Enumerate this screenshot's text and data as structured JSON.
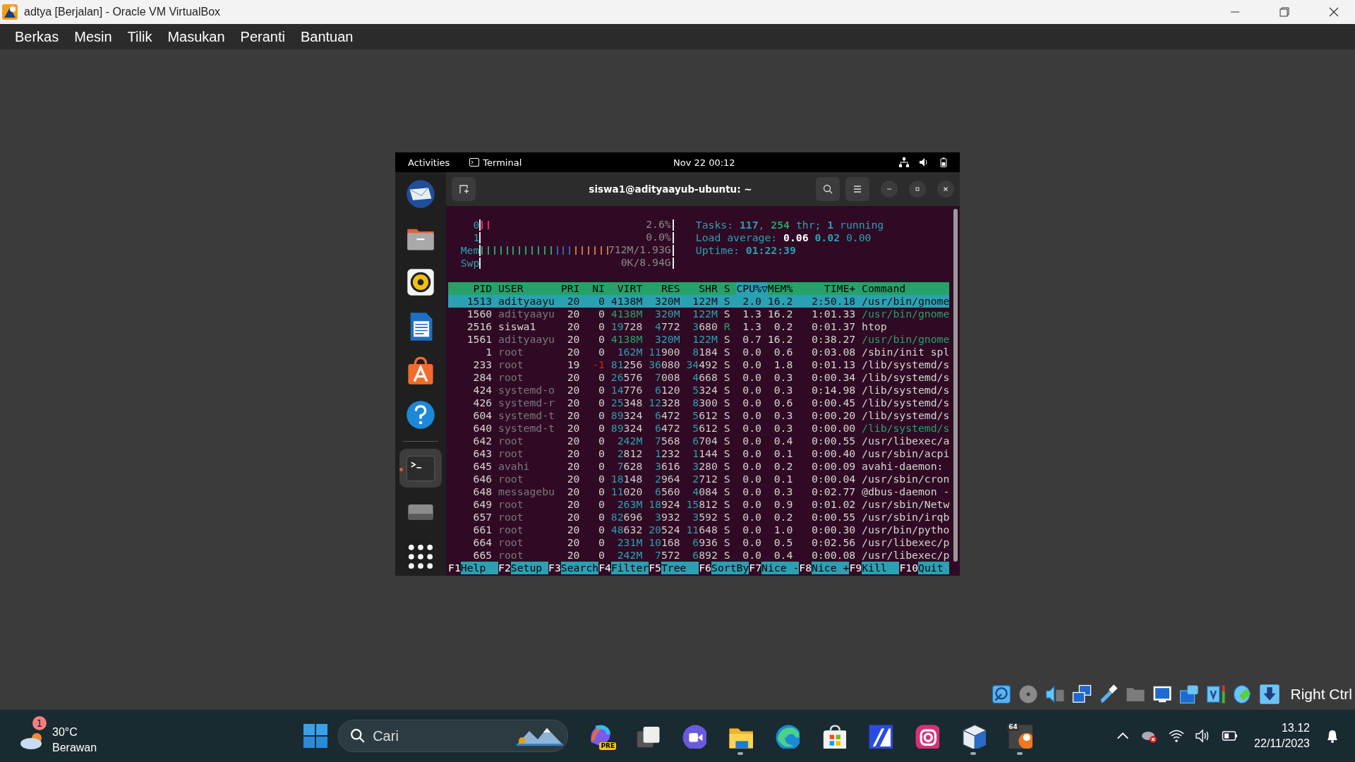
{
  "window": {
    "title": "adtya [Berjalan] - Oracle VM VirtualBox"
  },
  "menu": [
    "Berkas",
    "Mesin",
    "Tilik",
    "Masukan",
    "Peranti",
    "Bantuan"
  ],
  "guest": {
    "top_bar": {
      "activities": "Activities",
      "app": "Terminal",
      "clock": "Nov 22  00:12"
    },
    "dock": [
      {
        "kind": "mail",
        "selected": false
      },
      {
        "kind": "files",
        "selected": false
      },
      {
        "kind": "music",
        "selected": false
      },
      {
        "kind": "document",
        "selected": false
      },
      {
        "kind": "store",
        "selected": false
      },
      {
        "kind": "help",
        "selected": false
      },
      {
        "kind": "terminal",
        "selected": true
      },
      {
        "kind": "drive",
        "selected": false
      },
      {
        "kind": "apps",
        "selected": false
      }
    ],
    "terminal": {
      "title": "siswa1@adityaayub-ubuntu: ~",
      "meters": [
        {
          "label": "0",
          "kind": "cpu",
          "level": 0.06,
          "reading": "2.6%"
        },
        {
          "label": "1",
          "kind": "cpu",
          "level": 0,
          "reading": "0.0%"
        },
        {
          "label": "Mem",
          "kind": "memory",
          "level": 0.67,
          "reading": "712M/1.93G"
        },
        {
          "label": "Swp",
          "kind": "swap",
          "level": 0,
          "reading": "0K/8.94G"
        }
      ],
      "info": [
        [
          {
            "text": "Tasks: ",
            "kind": "label"
          },
          {
            "text": "117",
            "kind": "value"
          },
          {
            "text": ", ",
            "kind": "label"
          },
          {
            "text": "254",
            "kind": "thread"
          },
          {
            "text": " thr; ",
            "kind": "label"
          },
          {
            "text": "1",
            "kind": "value"
          },
          {
            "text": " running",
            "kind": "label"
          }
        ],
        [
          {
            "text": "Load average: ",
            "kind": "label"
          },
          {
            "text": "0.06",
            "kind": "high"
          },
          {
            "text": " 0.02",
            "kind": "value"
          },
          {
            "text": " 0.00",
            "kind": "label"
          }
        ],
        [
          {
            "text": "Uptime: ",
            "kind": "label"
          },
          {
            "text": "01:22:39",
            "kind": "value"
          }
        ]
      ],
      "columns": [
        {
          "label": "PID",
          "selected": false
        },
        {
          "label": "USER",
          "selected": false
        },
        {
          "label": "PRI",
          "selected": false
        },
        {
          "label": "NI",
          "selected": false
        },
        {
          "label": "VIRT",
          "selected": false
        },
        {
          "label": "RES",
          "selected": false
        },
        {
          "label": "SHR",
          "selected": false
        },
        {
          "label": "S",
          "selected": false
        },
        {
          "label": "CPU%▽",
          "selected": true
        },
        {
          "label": "MEM%",
          "selected": false
        },
        {
          "label": "TIME+",
          "selected": false
        },
        {
          "label": "Command",
          "selected": false
        }
      ],
      "rows": [
        {
          "pid": "1513",
          "user": "adityaayu",
          "pri": "20",
          "ni": "0",
          "virt": "4138M",
          "res": "320M",
          "shr": "122M",
          "state": "S",
          "cpu": "2.0",
          "mem": "16.2",
          "time": "2:50.18",
          "command": "/usr/bin/gnome",
          "selected": true
        },
        {
          "pid": "1560",
          "user": "adityaayu",
          "pri": "20",
          "ni": "0",
          "virt": "4138M",
          "res": "320M",
          "shr": "122M",
          "state": "S",
          "cpu": "1.3",
          "mem": "16.2",
          "time": "1:01.33",
          "command": "/usr/bin/gnome",
          "selected": false,
          "own_user": false,
          "thread": true,
          "running": false
        },
        {
          "pid": "2516",
          "user": "siswa1",
          "pri": "20",
          "ni": "0",
          "virt": "19728",
          "res": "4772",
          "shr": "3680",
          "state": "R",
          "cpu": "1.3",
          "mem": "0.2",
          "time": "0:01.37",
          "command": "htop",
          "selected": false,
          "own_user": true,
          "thread": false,
          "running": true
        },
        {
          "pid": "1561",
          "user": "adityaayu",
          "pri": "20",
          "ni": "0",
          "virt": "4138M",
          "res": "320M",
          "shr": "122M",
          "state": "S",
          "cpu": "0.7",
          "mem": "16.2",
          "time": "0:38.27",
          "command": "/usr/bin/gnome",
          "selected": false,
          "own_user": false,
          "thread": true,
          "running": false
        },
        {
          "pid": "1",
          "user": "root",
          "pri": "20",
          "ni": "0",
          "virt": "162M",
          "res": "11900",
          "shr": "8184",
          "state": "S",
          "cpu": "0.0",
          "mem": "0.6",
          "time": "0:03.08",
          "command": "/sbin/init spl",
          "selected": false,
          "own_user": false,
          "thread": false,
          "running": false
        },
        {
          "pid": "233",
          "user": "root",
          "pri": "19",
          "ni": "-1",
          "virt": "81256",
          "res": "36080",
          "shr": "34492",
          "state": "S",
          "cpu": "0.0",
          "mem": "1.8",
          "time": "0:01.13",
          "command": "/lib/systemd/s",
          "selected": false,
          "own_user": false,
          "thread": false,
          "running": false
        },
        {
          "pid": "284",
          "user": "root",
          "pri": "20",
          "ni": "0",
          "virt": "26576",
          "res": "7008",
          "shr": "4668",
          "state": "S",
          "cpu": "0.0",
          "mem": "0.3",
          "time": "0:00.34",
          "command": "/lib/systemd/s",
          "selected": false,
          "own_user": false,
          "thread": false,
          "running": false
        },
        {
          "pid": "424",
          "user": "systemd-o",
          "pri": "20",
          "ni": "0",
          "virt": "14776",
          "res": "6120",
          "shr": "5324",
          "state": "S",
          "cpu": "0.0",
          "mem": "0.3",
          "time": "0:14.98",
          "command": "/lib/systemd/s",
          "selected": false,
          "own_user": false,
          "thread": false,
          "running": false
        },
        {
          "pid": "426",
          "user": "systemd-r",
          "pri": "20",
          "ni": "0",
          "virt": "25348",
          "res": "12328",
          "shr": "8300",
          "state": "S",
          "cpu": "0.0",
          "mem": "0.6",
          "time": "0:00.45",
          "command": "/lib/systemd/s",
          "selected": false,
          "own_user": false,
          "thread": false,
          "running": false
        },
        {
          "pid": "604",
          "user": "systemd-t",
          "pri": "20",
          "ni": "0",
          "virt": "89324",
          "res": "6472",
          "shr": "5612",
          "state": "S",
          "cpu": "0.0",
          "mem": "0.3",
          "time": "0:00.20",
          "command": "/lib/systemd/s",
          "selected": false,
          "own_user": false,
          "thread": false,
          "running": false
        },
        {
          "pid": "640",
          "user": "systemd-t",
          "pri": "20",
          "ni": "0",
          "virt": "89324",
          "res": "6472",
          "shr": "5612",
          "state": "S",
          "cpu": "0.0",
          "mem": "0.3",
          "time": "0:00.00",
          "command": "/lib/systemd/s",
          "selected": false,
          "own_user": false,
          "thread": true,
          "running": false
        },
        {
          "pid": "642",
          "user": "root",
          "pri": "20",
          "ni": "0",
          "virt": "242M",
          "res": "7568",
          "shr": "6704",
          "state": "S",
          "cpu": "0.0",
          "mem": "0.4",
          "time": "0:00.55",
          "command": "/usr/libexec/a",
          "selected": false,
          "own_user": false,
          "thread": false,
          "running": false
        },
        {
          "pid": "643",
          "user": "root",
          "pri": "20",
          "ni": "0",
          "virt": "2812",
          "res": "1232",
          "shr": "1144",
          "state": "S",
          "cpu": "0.0",
          "mem": "0.1",
          "time": "0:00.40",
          "command": "/usr/sbin/acpi",
          "selected": false,
          "own_user": false,
          "thread": false,
          "running": false
        },
        {
          "pid": "645",
          "user": "avahi",
          "pri": "20",
          "ni": "0",
          "virt": "7628",
          "res": "3616",
          "shr": "3280",
          "state": "S",
          "cpu": "0.0",
          "mem": "0.2",
          "time": "0:00.09",
          "command": "avahi-daemon:",
          "selected": false,
          "own_user": false,
          "thread": false,
          "running": false
        },
        {
          "pid": "646",
          "user": "root",
          "pri": "20",
          "ni": "0",
          "virt": "18148",
          "res": "2964",
          "shr": "2712",
          "state": "S",
          "cpu": "0.0",
          "mem": "0.1",
          "time": "0:00.04",
          "command": "/usr/sbin/cron",
          "selected": false,
          "own_user": false,
          "thread": false,
          "running": false
        },
        {
          "pid": "648",
          "user": "messagebu",
          "pri": "20",
          "ni": "0",
          "virt": "11020",
          "res": "6560",
          "shr": "4084",
          "state": "S",
          "cpu": "0.0",
          "mem": "0.3",
          "time": "0:02.77",
          "command": "@dbus-daemon -",
          "selected": false,
          "own_user": false,
          "thread": false,
          "running": false
        },
        {
          "pid": "649",
          "user": "root",
          "pri": "20",
          "ni": "0",
          "virt": "263M",
          "res": "18924",
          "shr": "15812",
          "state": "S",
          "cpu": "0.0",
          "mem": "0.9",
          "time": "0:01.02",
          "command": "/usr/sbin/Netw",
          "selected": false,
          "own_user": false,
          "thread": false,
          "running": false
        },
        {
          "pid": "657",
          "user": "root",
          "pri": "20",
          "ni": "0",
          "virt": "82696",
          "res": "3932",
          "shr": "3592",
          "state": "S",
          "cpu": "0.0",
          "mem": "0.2",
          "time": "0:00.55",
          "command": "/usr/sbin/irqb",
          "selected": false,
          "own_user": false,
          "thread": false,
          "running": false
        },
        {
          "pid": "661",
          "user": "root",
          "pri": "20",
          "ni": "0",
          "virt": "48632",
          "res": "20524",
          "shr": "11648",
          "state": "S",
          "cpu": "0.0",
          "mem": "1.0",
          "time": "0:00.30",
          "command": "/usr/bin/pytho",
          "selected": false,
          "own_user": false,
          "thread": false,
          "running": false
        },
        {
          "pid": "664",
          "user": "root",
          "pri": "20",
          "ni": "0",
          "virt": "231M",
          "res": "10168",
          "shr": "6936",
          "state": "S",
          "cpu": "0.0",
          "mem": "0.5",
          "time": "0:02.56",
          "command": "/usr/libexec/p",
          "selected": false,
          "own_user": false,
          "thread": false,
          "running": false
        },
        {
          "pid": "665",
          "user": "root",
          "pri": "20",
          "ni": "0",
          "virt": "242M",
          "res": "7572",
          "shr": "6892",
          "state": "S",
          "cpu": "0.0",
          "mem": "0.4",
          "time": "0:00.08",
          "command": "/usr/libexec/p",
          "selected": false,
          "own_user": false,
          "thread": false,
          "running": false
        }
      ],
      "function_keys": [
        {
          "key": "F1",
          "label": "Help"
        },
        {
          "key": "F2",
          "label": "Setup"
        },
        {
          "key": "F3",
          "label": "Search"
        },
        {
          "key": "F4",
          "label": "Filter"
        },
        {
          "key": "F5",
          "label": "Tree"
        },
        {
          "key": "F6",
          "label": "SortBy"
        },
        {
          "key": "F7",
          "label": "Nice -"
        },
        {
          "key": "F8",
          "label": "Nice +"
        },
        {
          "key": "F9",
          "label": "Kill"
        },
        {
          "key": "F10",
          "label": "Quit"
        }
      ]
    }
  },
  "status_bar": {
    "icons": [
      {
        "kind": "disk"
      },
      {
        "kind": "optical"
      },
      {
        "kind": "audio"
      },
      {
        "kind": "network"
      },
      {
        "kind": "usb"
      },
      {
        "kind": "shared-folder"
      },
      {
        "kind": "display"
      },
      {
        "kind": "capture"
      },
      {
        "kind": "cpu"
      },
      {
        "kind": "mouse"
      },
      {
        "kind": "keyboard"
      }
    ],
    "host_key": "Right Ctrl"
  },
  "taskbar": {
    "weather": {
      "badge": "1",
      "temperature": "30°C",
      "condition": "Berawan"
    },
    "search": {
      "placeholder": "Cari"
    },
    "apps": [
      {
        "kind": "copilot",
        "badge": "PRE",
        "running": false
      },
      {
        "kind": "task-view",
        "running": false
      },
      {
        "kind": "meet",
        "running": false
      },
      {
        "kind": "explorer",
        "running": true
      },
      {
        "kind": "browser",
        "running": false
      },
      {
        "kind": "store",
        "running": false
      },
      {
        "kind": "editor",
        "running": false
      },
      {
        "kind": "camera",
        "running": false
      },
      {
        "kind": "cube",
        "running": true
      },
      {
        "kind": "vm",
        "badge": "64",
        "running": true
      }
    ],
    "clock": {
      "time": "13.12",
      "date": "22/11/2023"
    }
  }
}
